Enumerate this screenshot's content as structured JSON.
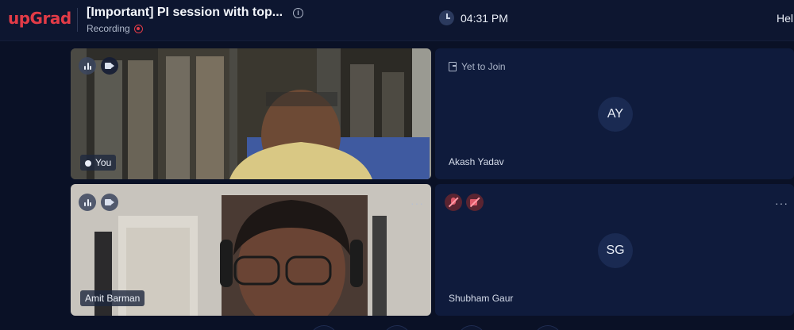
{
  "app": {
    "brand": "upGrad",
    "session_title": "[Important] PI session with top...",
    "recording_label": "Recording",
    "time": "04:31 PM",
    "help_label": "Hel"
  },
  "tiles": [
    {
      "name": "You",
      "status": "",
      "initials": ""
    },
    {
      "name": "Akash Yadav",
      "status": "Yet to Join",
      "initials": "AY"
    },
    {
      "name": "Amit Barman",
      "status": "",
      "initials": ""
    },
    {
      "name": "Shubham Gaur",
      "status": "",
      "initials": "SG"
    }
  ],
  "colors": {
    "brand": "#e23b47",
    "background": "#0a1126",
    "tile_empty": "#0f1b3c",
    "avatar": "#1a2a52"
  }
}
